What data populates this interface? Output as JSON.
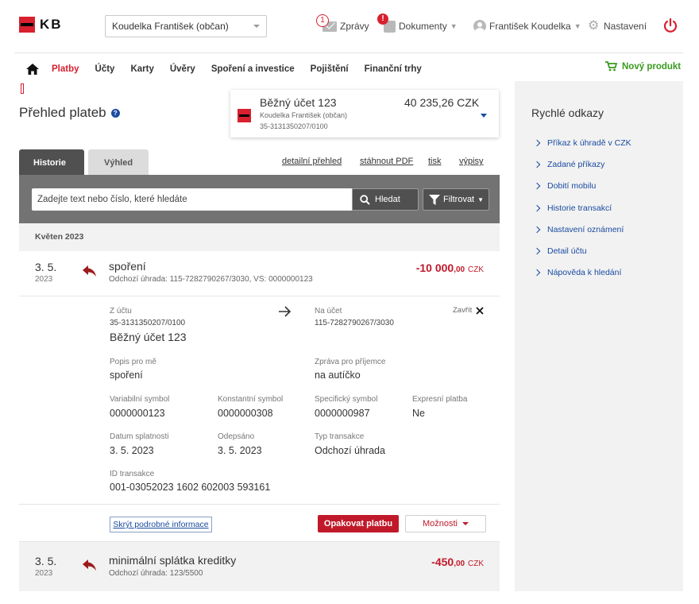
{
  "header": {
    "logo_text": "KB",
    "client_select": "Koudelka František (občan)",
    "messages": {
      "label": "Zprávy",
      "badge": "1"
    },
    "documents": {
      "label": "Dokumenty",
      "badge": "!"
    },
    "user": {
      "name": "František Koudelka"
    },
    "settings": {
      "label": "Nastavení"
    }
  },
  "nav": {
    "items": [
      {
        "label": "Platby"
      },
      {
        "label": "Účty"
      },
      {
        "label": "Karty"
      },
      {
        "label": "Úvěry"
      },
      {
        "label": "Spoření a investice"
      },
      {
        "label": "Pojištění"
      },
      {
        "label": "Finanční trhy"
      }
    ],
    "active": "Platby",
    "new_product": "Nový produkt"
  },
  "page": {
    "title": "Přehled plateb",
    "account": {
      "name": "Běžný účet 123",
      "owner": "Koudelka František (občan)",
      "number": "35-3131350207/0100",
      "balance": "40 235,26 CZK"
    },
    "tabs": [
      {
        "label": "Historie"
      },
      {
        "label": "Výhled"
      }
    ],
    "tab_links": [
      {
        "label": "detailní přehled"
      },
      {
        "label": "stáhnout PDF"
      },
      {
        "label": "tisk"
      },
      {
        "label": "výpisy"
      }
    ],
    "search": {
      "placeholder": "Zadejte text nebo číslo, které hledáte",
      "search_button": "Hledat",
      "filter_button": "Filtrovat"
    },
    "month": "Květen 2023"
  },
  "transactions": [
    {
      "day": "3. 5.",
      "year": "2023",
      "title": "spoření",
      "subtitle": "Odchozí úhrada: 115-7282790267/3030, VS: 0000000123",
      "amount_main": "-10 000",
      "amount_dec": ",00",
      "currency": "CZK"
    },
    {
      "day": "3. 5.",
      "year": "2023",
      "title": "minimální splátka kreditky",
      "subtitle": "Odchozí úhrada: 123/5500",
      "amount_main": "-450",
      "amount_dec": ",00",
      "currency": "CZK"
    }
  ],
  "detail": {
    "from_label": "Z účtu",
    "from_number": "35-3131350207/0100",
    "from_name": "Běžný účet 123",
    "to_label": "Na účet",
    "to_number": "115-7282790267/3030",
    "close_label": "Zavřít",
    "note_label": "Popis pro mě",
    "note_value": "spoření",
    "msg_label": "Zpráva pro příjemce",
    "msg_value": "na autíčko",
    "vs_label": "Variabilní symbol",
    "vs_value": "0000000123",
    "ks_label": "Konstantní symbol",
    "ks_value": "0000000308",
    "ss_label": "Specifický symbol",
    "ss_value": "0000000987",
    "express_label": "Expresní platba",
    "express_value": "Ne",
    "due_label": "Datum splatnosti",
    "due_value": "3. 5. 2023",
    "debited_label": "Odepsáno",
    "debited_value": "3. 5. 2023",
    "type_label": "Typ transakce",
    "type_value": "Odchozí úhrada",
    "id_label": "ID transakce",
    "id_value": "001-03052023 1602 602003 593161",
    "hide_button": "Skrýt podrobné informace",
    "repeat_button": "Opakovat platbu",
    "options_button": "Možnosti"
  },
  "quick_links": {
    "title": "Rychlé odkazy",
    "items": [
      {
        "label": "Příkaz k úhradě v CZK"
      },
      {
        "label": "Zadané příkazy"
      },
      {
        "label": "Dobití mobilu"
      },
      {
        "label": "Historie transakcí"
      },
      {
        "label": "Nastavení oznámení"
      },
      {
        "label": "Detail účtu"
      },
      {
        "label": "Nápověda k hledání"
      }
    ]
  },
  "colors": {
    "brand_red": "#d8202f",
    "amount_red": "#c01a2a",
    "link_blue": "#1a4ba0",
    "new_product_green": "#3a9a1f"
  }
}
